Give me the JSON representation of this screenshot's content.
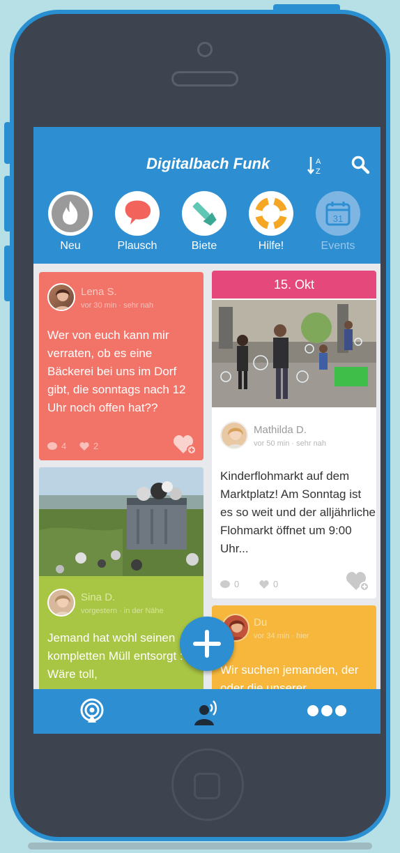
{
  "header": {
    "title": "Digitalbach Funk"
  },
  "categories": [
    {
      "label": "Neu",
      "icon": "fire-icon"
    },
    {
      "label": "Plausch",
      "icon": "chat-bubble-icon"
    },
    {
      "label": "Biete",
      "icon": "flashlight-icon"
    },
    {
      "label": "Hilfe!",
      "icon": "lifebuoy-icon"
    },
    {
      "label": "Events",
      "icon": "calendar-icon",
      "calendar_day": "31"
    }
  ],
  "posts": [
    {
      "author": "Lena S.",
      "meta": "vor 30 min  ·  sehr nah",
      "text": "Wer von euch kann mir verraten, ob es eine Bäckerei bei uns im Dorf gibt, die sonntags nach 12 Uhr noch offen hat??",
      "comments": "4",
      "likes": "2",
      "color": "#f27468"
    },
    {
      "author": "Sina D.",
      "meta": "vorgestern  ·  in der Nähe",
      "text": "Jemand hat wohl seinen kompletten Müll entsorgt :-( Wäre toll,",
      "color": "#a8c544"
    },
    {
      "event_date": "15. Okt",
      "author": "Mathilda D.",
      "meta": "vor 50 min  ·  sehr nah",
      "text": "Kinderflohmarkt auf dem Marktplatz! Am Sonntag ist es so weit und der alljährliche Flohmarkt öffnet um 9:00 Uhr...",
      "comments": "0",
      "likes": "0",
      "color": "#e5497b"
    },
    {
      "author": "Du",
      "meta": "vor 34 min  ·  hier",
      "text": "Wir suchen jemanden, der oder die unserer",
      "color": "#f6b73c"
    }
  ],
  "fab": {
    "icon": "plus-icon"
  },
  "bottom_nav": [
    {
      "icon": "broadcast-icon"
    },
    {
      "icon": "user-speaking-icon"
    },
    {
      "icon": "more-dots-icon"
    }
  ]
}
